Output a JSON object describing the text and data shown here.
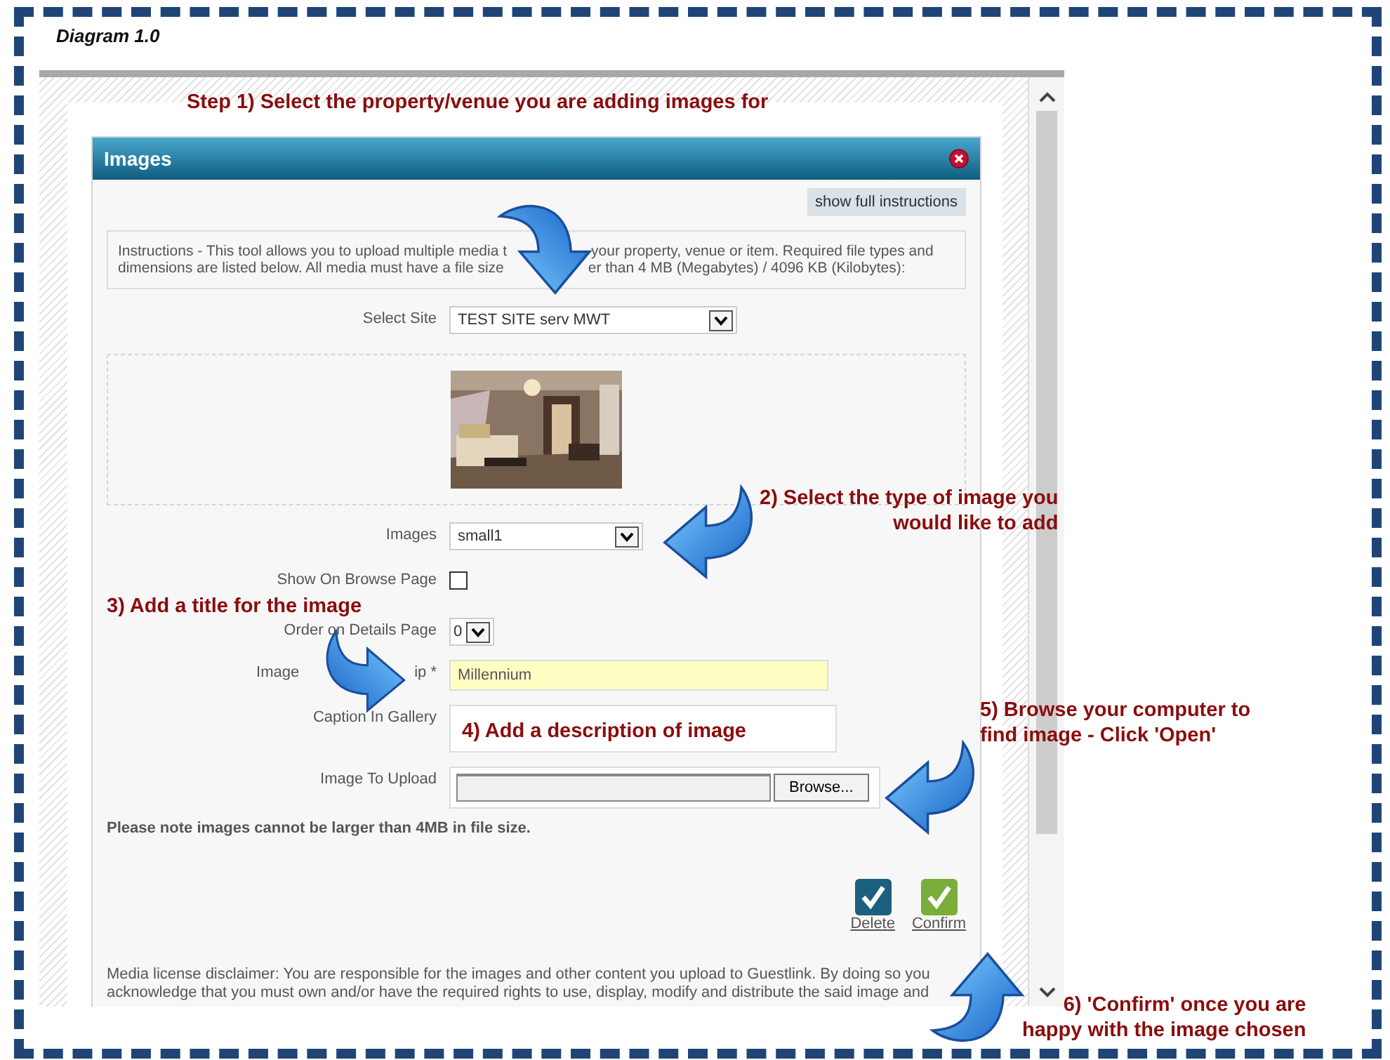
{
  "diagram_title": "Diagram 1.0",
  "dialog": {
    "title": "Images",
    "instructions_button": "show full instructions",
    "instructions": [
      [
        "Instructions - This tool allows you to upload multiple media t",
        "your property, venue or item. Required file types and"
      ],
      [
        "dimensions are listed below. All media must have a file size",
        "er than 4 MB (Megabytes) / 4096 KB (Kilobytes):"
      ]
    ],
    "fields": [
      {
        "kind": "select",
        "label": [
          "Select Site"
        ],
        "value": "TEST SITE serv MWT"
      },
      {
        "kind": "picture"
      },
      {
        "kind": "select",
        "label": [
          "Images"
        ],
        "value": "small1"
      },
      {
        "kind": "checkbox",
        "label": [
          "Show On Browse Page"
        ],
        "checked": false
      },
      {
        "kind": "select-small",
        "label": [
          "Order on Details Page"
        ],
        "value": "0"
      },
      {
        "kind": "text",
        "label": [
          "Image",
          "ip *"
        ],
        "value": "Millennium"
      },
      {
        "kind": "textarea",
        "label": [
          "Caption In Gallery"
        ]
      },
      {
        "kind": "file",
        "label": [
          "Image To Upload"
        ],
        "button": "Browse..."
      }
    ],
    "note": "Please note images cannot be larger than 4MB in file size.",
    "actions": [
      {
        "label": "Delete",
        "color": "#1d5f7e"
      },
      {
        "label": "Confirm",
        "color": "#7aad3a"
      }
    ],
    "disclaimer": [
      "Media license disclaimer: You are responsible for the images and other content you upload to Guestlink. By doing so you",
      "acknowledge that you must own and/or have the required rights to use, display, modify and distribute the said image and"
    ]
  },
  "annotations": [
    {
      "lines": [
        "Step 1) Select the property/venue you are adding images for"
      ]
    },
    {
      "lines": [
        "2) Select the type of image you",
        "would like to add"
      ]
    },
    {
      "lines": [
        "3) Add a title for the image"
      ]
    },
    {
      "lines": [
        "4) Add a description of image"
      ]
    },
    {
      "lines": [
        "5) Browse your computer to",
        "find image - Click 'Open'"
      ]
    },
    {
      "lines": [
        "6) 'Confirm' once you are",
        "happy with the image chosen"
      ]
    }
  ]
}
